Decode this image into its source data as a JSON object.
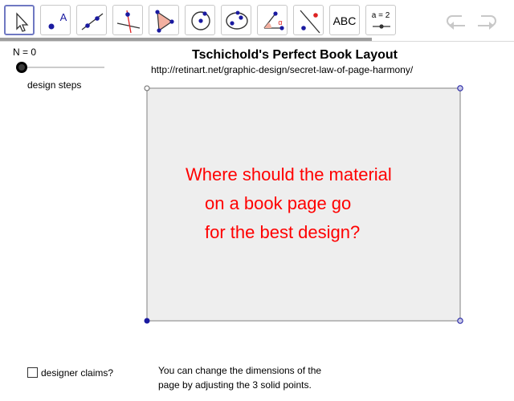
{
  "toolbar": {
    "tools": [
      {
        "icon": "move-arrow-icon"
      },
      {
        "icon": "point-icon",
        "label": "A"
      },
      {
        "icon": "line-icon"
      },
      {
        "icon": "perpendicular-line-icon"
      },
      {
        "icon": "polygon-icon"
      },
      {
        "icon": "circle-center-icon"
      },
      {
        "icon": "ellipse-icon"
      },
      {
        "icon": "angle-icon",
        "label": "α"
      },
      {
        "icon": "reflect-icon"
      },
      {
        "icon": "text-tool-icon",
        "label": "ABC"
      },
      {
        "icon": "slider-tool-icon",
        "label": "a = 2"
      }
    ],
    "undo_icon": "undo-icon",
    "redo_icon": "redo-icon"
  },
  "slider": {
    "label": "N = 0",
    "caption": "design steps"
  },
  "title": "Tschichold's Perfect Book Layout",
  "url": "http://retinart.net/graphic-design/secret-law-of-page-harmony/",
  "question": {
    "line1": "Where should the material",
    "line2": "on a book page go",
    "line3": "for the best design?"
  },
  "checkbox": {
    "label": "designer claims?",
    "checked": false
  },
  "note": {
    "line1": "You can change the dimensions of the",
    "line2": "page by adjusting the 3 solid points."
  },
  "colors": {
    "question": "#ff0000",
    "page_fill": "#eeeeee",
    "point_blue": "#1a1aa0",
    "active_tool": "#6f78c2"
  }
}
